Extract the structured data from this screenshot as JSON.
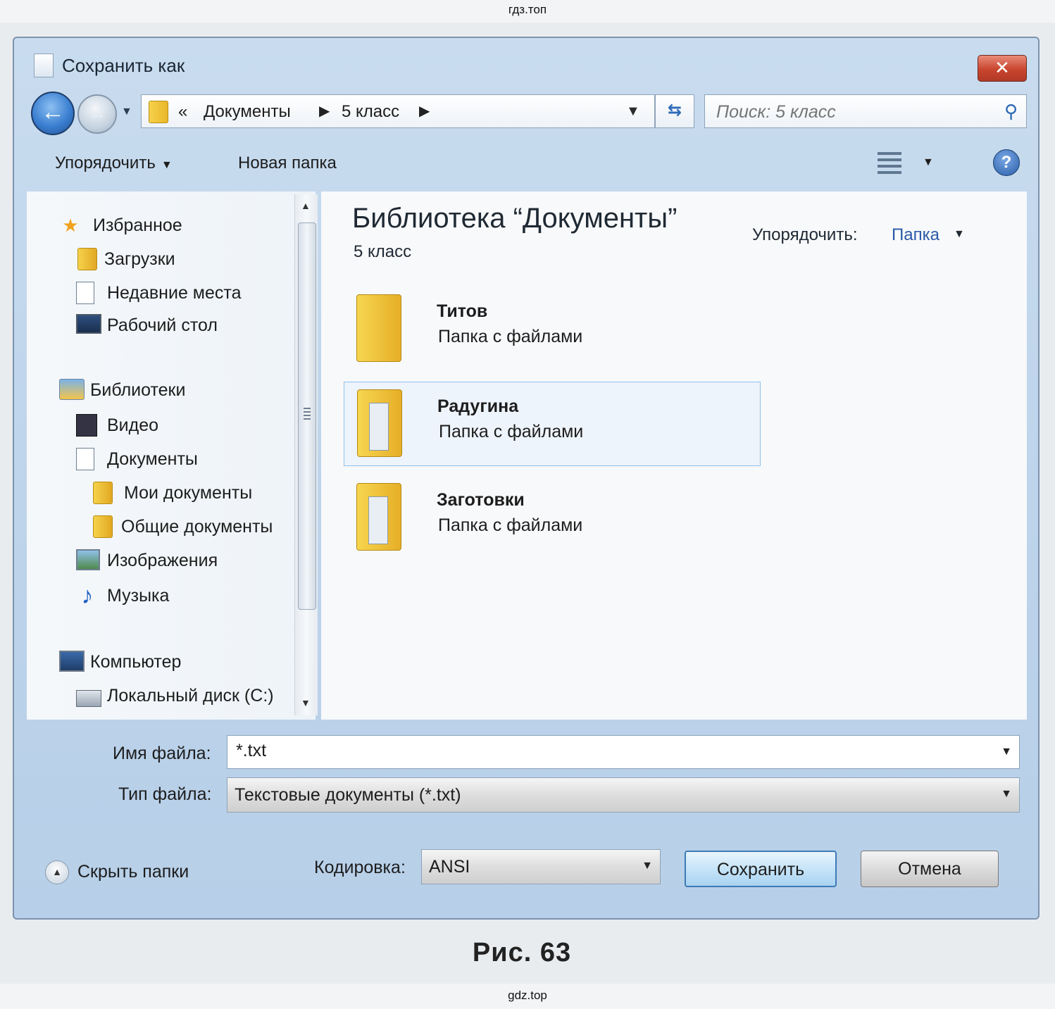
{
  "watermark_top": "гдз.топ",
  "watermark_bottom": "gdz.top",
  "window": {
    "title": "Сохранить как",
    "close": "✕"
  },
  "address": {
    "quote": "«",
    "crumbs": [
      "Документы",
      "5 класс"
    ],
    "search_placeholder": "Поиск: 5 класс"
  },
  "toolbar": {
    "arrange": "Упорядочить",
    "new_folder": "Новая папка",
    "help": "?"
  },
  "nav": {
    "favorites": "Избранное",
    "downloads": "Загрузки",
    "recent": "Недавние места",
    "desktop": "Рабочий стол",
    "libraries": "Библиотеки",
    "video": "Видео",
    "documents": "Документы",
    "my_docs": "Мои документы",
    "public_docs": "Общие документы",
    "images": "Изображения",
    "music": "Музыка",
    "computer": "Компьютер",
    "local_disk": "Локальный диск (C:)"
  },
  "main": {
    "library_title": "Библиотека “Документы”",
    "subtitle": "5 класс",
    "arrange_label": "Упорядочить:",
    "arrange_value": "Папка",
    "items": [
      {
        "name": "Титов",
        "type": "Папка с файлами"
      },
      {
        "name": "Радугина",
        "type": "Папка с файлами"
      },
      {
        "name": "Заготовки",
        "type": "Папка с файлами"
      }
    ]
  },
  "form": {
    "filename_label": "Имя файла:",
    "filename_value": "*.txt",
    "filetype_label": "Тип файла:",
    "filetype_value": "Текстовые документы (*.txt)",
    "hide_folders": "Скрыть папки",
    "encoding_label": "Кодировка:",
    "encoding_value": "ANSI",
    "save": "Сохранить",
    "cancel": "Отмена"
  },
  "caption": "Рис. 63"
}
